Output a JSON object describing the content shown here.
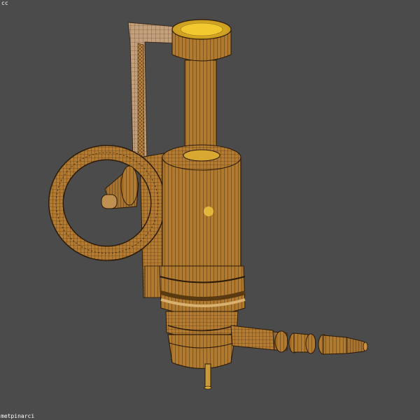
{
  "viewport": {
    "corner_label": "cc",
    "credit_label": "metpinarci",
    "background_color": "#4b4b4b",
    "model_colors": {
      "brass_dark": "#a8742c",
      "brass_mid": "#c28a3c",
      "brass_light": "#d9a85a",
      "cap_top": "#e0b830",
      "wire": "#2a1a08",
      "tan_bracket": "#c9a37a"
    },
    "object": "wireframe-brass-valve-model"
  }
}
